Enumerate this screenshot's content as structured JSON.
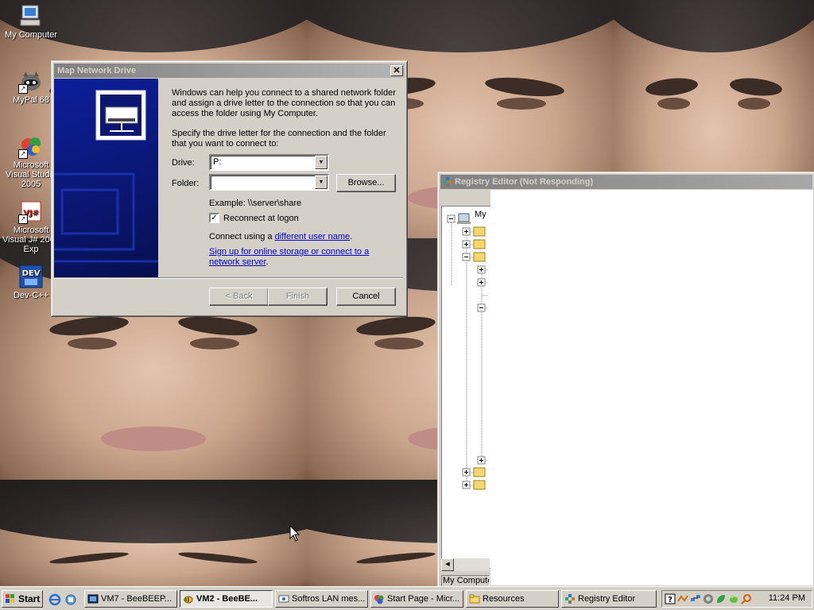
{
  "desktop": {
    "icons": [
      {
        "label": "My Computer",
        "icon": "my-computer-icon"
      },
      {
        "label": "MyPal 68",
        "icon": "mypal-raccoon-icon"
      },
      {
        "label": "Microsoft Visual Studio 2005",
        "icon": "visual-studio-icon"
      },
      {
        "label": "Microsoft Visual J# 2005 Exp",
        "icon": "vjsharp-icon"
      },
      {
        "label": "Dev-C++",
        "icon": "devcpp-icon"
      }
    ]
  },
  "dialog": {
    "title": "Map Network Drive",
    "intro": "Windows can help you connect to a shared network folder and assign a drive letter to the connection so that you can access the folder using My Computer.",
    "instruction": "Specify the drive letter for the connection and the folder that you want to connect to:",
    "drive_label": "Drive:",
    "drive_value": "P:",
    "folder_label": "Folder:",
    "folder_value": "",
    "browse_label": "Browse...",
    "example": "Example: \\\\server\\share",
    "reconnect_label": "Reconnect at logon",
    "reconnect_checked": true,
    "connect_prefix": "Connect using a ",
    "connect_link": "different user name",
    "connect_suffix": ".",
    "signup_link": "Sign up for online storage or connect to a network server",
    "signup_suffix": ".",
    "back_label": "< Back",
    "finish_label": "Finish",
    "cancel_label": "Cancel",
    "close_glyph": "✕"
  },
  "registry": {
    "title": "Registry Editor (Not Responding)",
    "root_label": "My",
    "status_text": "My Computer"
  },
  "taskbar": {
    "start_label": "Start",
    "tasks": [
      {
        "label": "VM7 - BeeBEEP...",
        "active": false
      },
      {
        "label": "VM2 - BeeBE...",
        "active": true
      },
      {
        "label": "Softros LAN mes...",
        "active": false
      },
      {
        "label": "Start Page - Micr...",
        "active": false
      },
      {
        "label": "Resources",
        "active": false
      },
      {
        "label": "Registry Editor",
        "active": false
      }
    ],
    "clock": "11:24 PM"
  },
  "colors": {
    "link": "#0000cc",
    "dialog_banner": "#0a1a8a",
    "inactive_title_start": "#808080",
    "inactive_title_end": "#b5b5b5"
  }
}
